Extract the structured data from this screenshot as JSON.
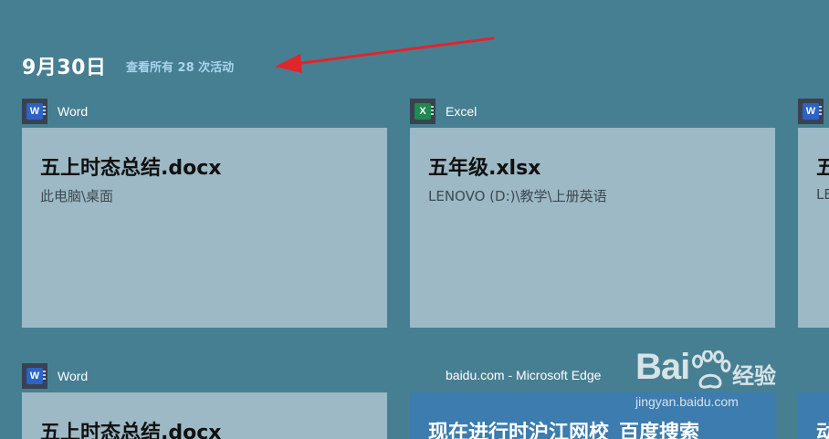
{
  "timeline": {
    "date_heading": "9月30日",
    "see_all_link": "查看所有 28 次活动"
  },
  "apps": {
    "word": "Word",
    "excel": "Excel",
    "edge": "baidu.com - Microsoft Edge"
  },
  "cards": [
    {
      "title": "五上时态总结.docx",
      "subtitle": "此电脑\\桌面"
    },
    {
      "title": "五年级.xlsx",
      "subtitle": "LENOVO (D:)\\教学\\上册英语"
    },
    {
      "title": "五",
      "subtitle": "LE"
    },
    {
      "title": "五上时态总结.docx",
      "subtitle": ""
    },
    {
      "title": "现在进行时沪江网校_百度搜索",
      "subtitle": ""
    },
    {
      "title": "动",
      "subtitle": ""
    }
  ],
  "icons": {
    "word": "W",
    "excel": "X"
  },
  "watermark": {
    "logo": "Bai",
    "text": "经验",
    "url": "jingyan.baidu.com"
  },
  "colors": {
    "background": "#477f92",
    "card": "#9cb9c5",
    "edge_card": "#3c7cae",
    "link": "#a8d4ee",
    "arrow": "#e0252b"
  }
}
